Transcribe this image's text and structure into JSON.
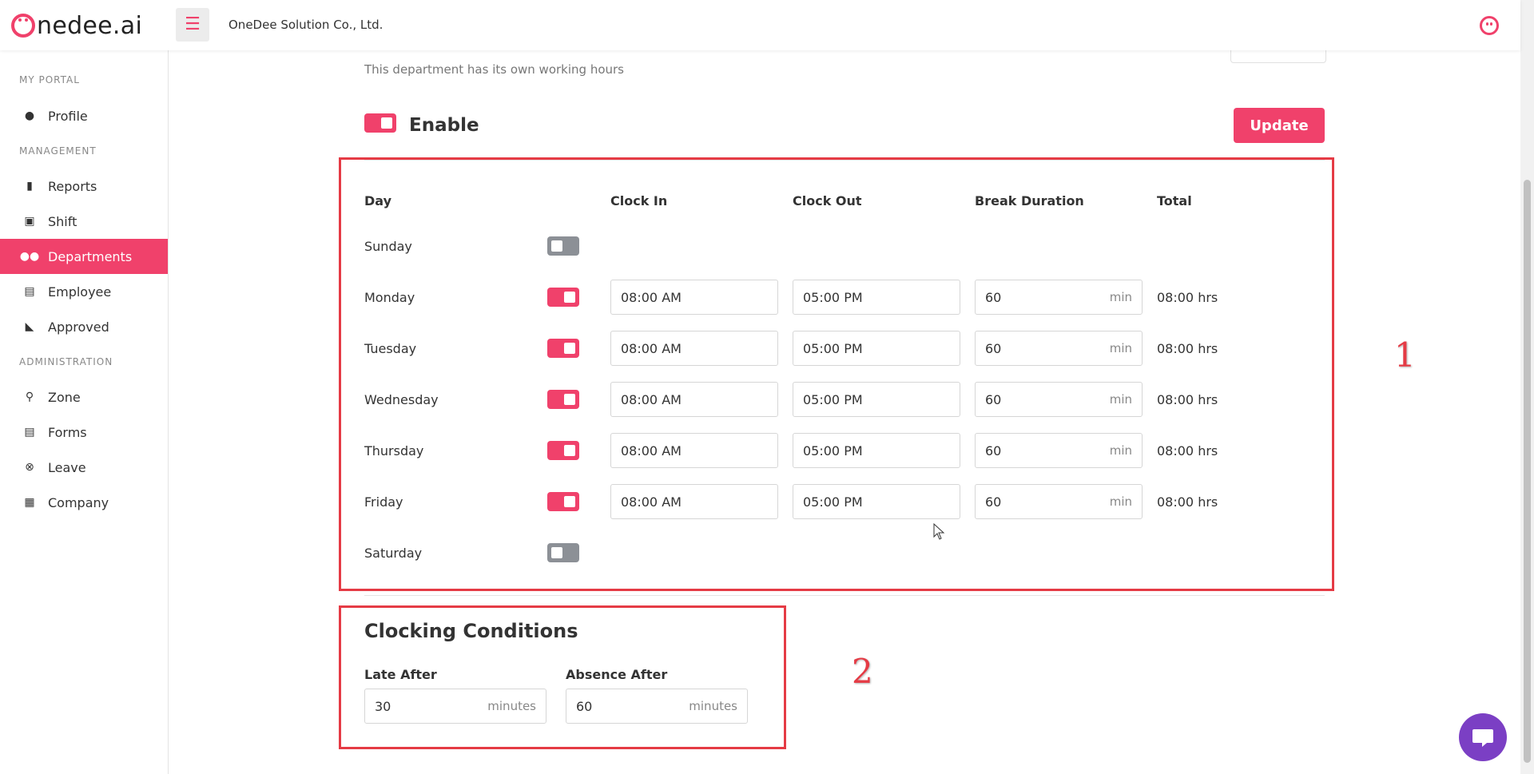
{
  "header": {
    "logo_text": "nedee.ai",
    "company_name": "OneDee Solution Co., Ltd."
  },
  "sidebar": {
    "sections": [
      {
        "label": "MY PORTAL"
      },
      {
        "label": "MANAGEMENT"
      },
      {
        "label": "ADMINISTRATION"
      }
    ],
    "items": [
      {
        "label": "Profile",
        "icon": "user-circle-icon"
      },
      {
        "label": "Reports",
        "icon": "document-icon"
      },
      {
        "label": "Shift",
        "icon": "briefcase-clock-icon"
      },
      {
        "label": "Departments",
        "icon": "users-icon",
        "active": true
      },
      {
        "label": "Employee",
        "icon": "id-card-icon"
      },
      {
        "label": "Approved",
        "icon": "inbox-icon"
      },
      {
        "label": "Zone",
        "icon": "map-pin-icon"
      },
      {
        "label": "Forms",
        "icon": "clipboard-icon"
      },
      {
        "label": "Leave",
        "icon": "x-circle-icon"
      },
      {
        "label": "Company",
        "icon": "building-icon"
      }
    ]
  },
  "working_hours": {
    "subtitle": "This department has its own working hours",
    "enable_label": "Enable",
    "enabled": true,
    "update_label": "Update",
    "columns": {
      "day": "Day",
      "clock_in": "Clock In",
      "clock_out": "Clock Out",
      "break_duration": "Break Duration",
      "total": "Total"
    },
    "break_unit": "min",
    "days": [
      {
        "name": "Sunday",
        "enabled": false
      },
      {
        "name": "Monday",
        "enabled": true,
        "clock_in": "08:00 AM",
        "clock_out": "05:00 PM",
        "break": "60",
        "total": "08:00 hrs"
      },
      {
        "name": "Tuesday",
        "enabled": true,
        "clock_in": "08:00 AM",
        "clock_out": "05:00 PM",
        "break": "60",
        "total": "08:00 hrs"
      },
      {
        "name": "Wednesday",
        "enabled": true,
        "clock_in": "08:00 AM",
        "clock_out": "05:00 PM",
        "break": "60",
        "total": "08:00 hrs"
      },
      {
        "name": "Thursday",
        "enabled": true,
        "clock_in": "08:00 AM",
        "clock_out": "05:00 PM",
        "break": "60",
        "total": "08:00 hrs"
      },
      {
        "name": "Friday",
        "enabled": true,
        "clock_in": "08:00 AM",
        "clock_out": "05:00 PM",
        "break": "60",
        "total": "08:00 hrs"
      },
      {
        "name": "Saturday",
        "enabled": false
      }
    ]
  },
  "clocking_conditions": {
    "title": "Clocking Conditions",
    "late_after_label": "Late After",
    "late_after_value": "30",
    "absence_after_label": "Absence After",
    "absence_after_value": "60",
    "unit": "minutes"
  },
  "annotations": {
    "box1_number": "1",
    "box2_number": "2"
  },
  "colors": {
    "accent": "#f0416b",
    "annotation": "#e53b45",
    "toggle_off": "#8c9096",
    "chat": "#7b3fc4"
  }
}
